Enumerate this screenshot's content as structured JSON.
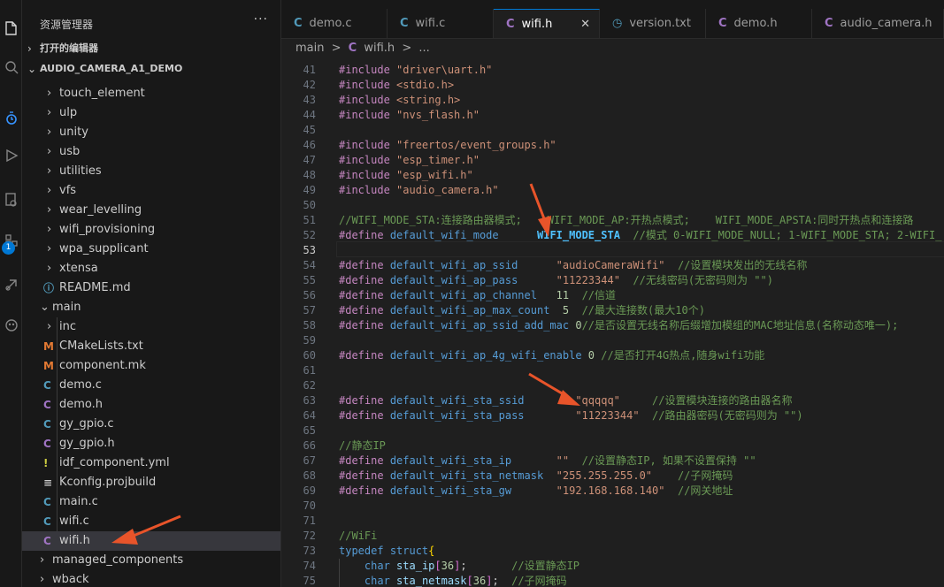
{
  "sidebar": {
    "title": "资源管理器",
    "more": "···",
    "open_editors": "打开的编辑器",
    "project": "AUDIO_CAMERA_A1_DEMO",
    "tree": [
      {
        "label": "touch_element",
        "type": "folder",
        "depth": 1,
        "expanded": false
      },
      {
        "label": "ulp",
        "type": "folder",
        "depth": 1,
        "expanded": false
      },
      {
        "label": "unity",
        "type": "folder",
        "depth": 1,
        "expanded": false
      },
      {
        "label": "usb",
        "type": "folder",
        "depth": 1,
        "expanded": false
      },
      {
        "label": "utilities",
        "type": "folder",
        "depth": 1,
        "expanded": false
      },
      {
        "label": "vfs",
        "type": "folder",
        "depth": 1,
        "expanded": false
      },
      {
        "label": "wear_levelling",
        "type": "folder",
        "depth": 1,
        "expanded": false
      },
      {
        "label": "wifi_provisioning",
        "type": "folder",
        "depth": 1,
        "expanded": false
      },
      {
        "label": "wpa_supplicant",
        "type": "folder",
        "depth": 1,
        "expanded": false
      },
      {
        "label": "xtensa",
        "type": "folder",
        "depth": 1,
        "expanded": false
      },
      {
        "label": "README.md",
        "type": "info",
        "icon": "ⓘ",
        "depth": 1
      },
      {
        "label": "main",
        "type": "folder",
        "depth": 0,
        "expanded": true
      },
      {
        "label": "inc",
        "type": "folder",
        "depth": 1,
        "expanded": false
      },
      {
        "label": "CMakeLists.txt",
        "type": "cmake",
        "icon": "M",
        "depth": 1
      },
      {
        "label": "component.mk",
        "type": "cmake",
        "icon": "M",
        "depth": 1
      },
      {
        "label": "demo.c",
        "type": "c",
        "icon": "C",
        "depth": 1
      },
      {
        "label": "demo.h",
        "type": "h",
        "icon": "C",
        "depth": 1
      },
      {
        "label": "gy_gpio.c",
        "type": "c",
        "icon": "C",
        "depth": 1
      },
      {
        "label": "gy_gpio.h",
        "type": "h",
        "icon": "C",
        "depth": 1
      },
      {
        "label": "idf_component.yml",
        "type": "yml",
        "icon": "!",
        "depth": 1
      },
      {
        "label": "Kconfig.projbuild",
        "type": "kconfig",
        "icon": "≡",
        "depth": 1
      },
      {
        "label": "main.c",
        "type": "c",
        "icon": "C",
        "depth": 1
      },
      {
        "label": "wifi.c",
        "type": "c",
        "icon": "C",
        "depth": 1
      },
      {
        "label": "wifi.h",
        "type": "h",
        "icon": "C",
        "depth": 1,
        "selected": true
      },
      {
        "label": "managed_components",
        "type": "folder",
        "depth": 0,
        "expanded": false
      },
      {
        "label": "wback",
        "type": "folder",
        "depth": 0,
        "expanded": false
      }
    ]
  },
  "tabs": [
    {
      "label": "demo.c",
      "icon": "C",
      "kind": "c"
    },
    {
      "label": "wifi.c",
      "icon": "C",
      "kind": "c"
    },
    {
      "label": "wifi.h",
      "icon": "C",
      "kind": "h",
      "active": true,
      "close": "✕"
    },
    {
      "label": "version.txt",
      "icon": "◷",
      "kind": "txt"
    },
    {
      "label": "demo.h",
      "icon": "C",
      "kind": "h"
    },
    {
      "label": "audio_camera.h",
      "icon": "C",
      "kind": "h"
    }
  ],
  "breadcrumb": [
    "main",
    ">",
    "C",
    "wifi.h",
    ">",
    "..."
  ],
  "activity": {
    "badge": "1"
  },
  "colors": {
    "accent": "#0078d4",
    "arrow": "#e8542a",
    "c_icon": "#519aba",
    "h_icon": "#a074c4",
    "cmake_icon": "#e37933",
    "yml_icon": "#cbcb41"
  },
  "code": [
    {
      "n": "41",
      "t": "#include \"driver\\uart.h\""
    },
    {
      "n": "42",
      "t": "#include <stdio.h>"
    },
    {
      "n": "43",
      "t": "#include <string.h>"
    },
    {
      "n": "44",
      "t": "#include \"nvs_flash.h\""
    },
    {
      "n": "45",
      "t": ""
    },
    {
      "n": "46",
      "t": "#include \"freertos/event_groups.h\""
    },
    {
      "n": "47",
      "t": "#include \"esp_timer.h\""
    },
    {
      "n": "48",
      "t": "#include \"esp_wifi.h\""
    },
    {
      "n": "49",
      "t": "#include \"audio_camera.h\""
    },
    {
      "n": "50",
      "t": ""
    },
    {
      "n": "51",
      "t": "//WIFI_MODE_STA:连接路由器模式;    WIFI_MODE_AP:开热点模式;    WIFI_MODE_APSTA:同时开热点和连接路"
    },
    {
      "n": "52",
      "t": "#define default_wifi_mode      WIFI_MODE_STA  //模式 0-WIFI_MODE_NULL; 1-WIFI_MODE_STA; 2-WIFI_"
    },
    {
      "n": "53",
      "t": ""
    },
    {
      "n": "54",
      "t": "#define default_wifi_ap_ssid      \"audioCameraWifi\"  //设置模块发出的无线名称"
    },
    {
      "n": "55",
      "t": "#define default_wifi_ap_pass      \"11223344\"  //无线密码(无密码则为 \"\")"
    },
    {
      "n": "56",
      "t": "#define default_wifi_ap_channel   11  //信道"
    },
    {
      "n": "57",
      "t": "#define default_wifi_ap_max_count  5  //最大连接数(最大10个)"
    },
    {
      "n": "58",
      "t": "#define default_wifi_ap_ssid_add_mac 0//是否设置无线名称后缀增加模组的MAC地址信息(名称动态唯一);"
    },
    {
      "n": "59",
      "t": ""
    },
    {
      "n": "60",
      "t": "#define default_wifi_ap_4g_wifi_enable 0 //是否打开4G热点,随身wifi功能"
    },
    {
      "n": "61",
      "t": ""
    },
    {
      "n": "62",
      "t": ""
    },
    {
      "n": "63",
      "t": "#define default_wifi_sta_ssid        \"qqqqq\"     //设置模块连接的路由器名称"
    },
    {
      "n": "64",
      "t": "#define default_wifi_sta_pass        \"11223344\"  //路由器密码(无密码则为 \"\")"
    },
    {
      "n": "65",
      "t": ""
    },
    {
      "n": "66",
      "t": "//静态IP"
    },
    {
      "n": "67",
      "t": "#define default_wifi_sta_ip       \"\"  //设置静态IP, 如果不设置保持 \"\""
    },
    {
      "n": "68",
      "t": "#define default_wifi_sta_netmask  \"255.255.255.0\"    //子网掩码"
    },
    {
      "n": "69",
      "t": "#define default_wifi_sta_gw       \"192.168.168.140\"  //网关地址"
    },
    {
      "n": "70",
      "t": ""
    },
    {
      "n": "71",
      "t": ""
    },
    {
      "n": "72",
      "t": "//WiFi"
    },
    {
      "n": "73",
      "t": "typedef struct{"
    },
    {
      "n": "74",
      "t": "    char sta_ip[36];       //设置静态IP"
    },
    {
      "n": "75",
      "t": "    char sta_netmask[36];  //子网掩码"
    }
  ]
}
